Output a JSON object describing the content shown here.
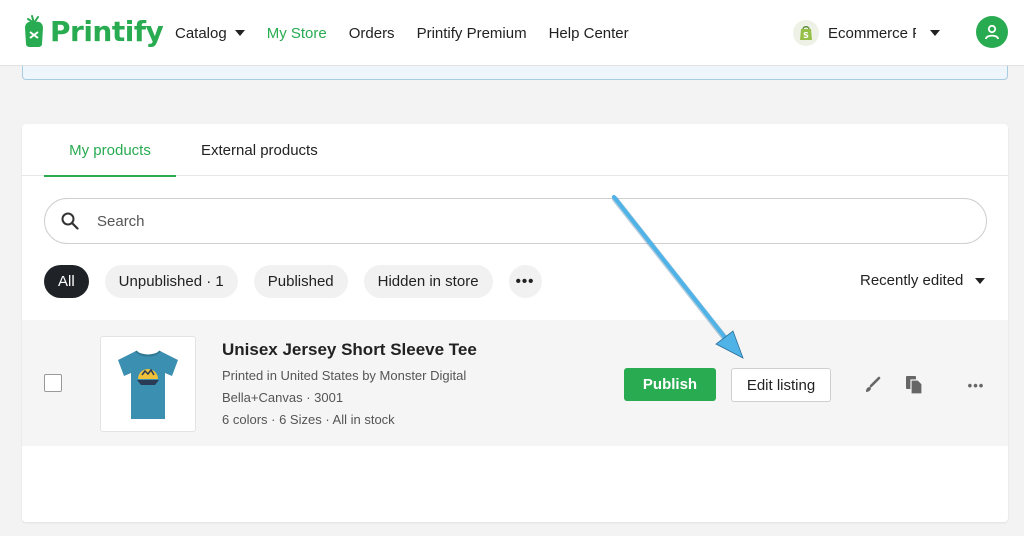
{
  "header": {
    "logo_text": "Printify",
    "nav": [
      {
        "label": "Catalog"
      },
      {
        "label": "My Store"
      },
      {
        "label": "Orders"
      },
      {
        "label": "Printify Premium"
      },
      {
        "label": "Help Center"
      }
    ],
    "store_name": "Ecommerce Platforms",
    "store_icon": "shopify-icon",
    "avatar_icon": "user-icon"
  },
  "tabs": [
    {
      "label": "My products"
    },
    {
      "label": "External products"
    }
  ],
  "search": {
    "placeholder": "Search",
    "value": ""
  },
  "filters": [
    {
      "label": "All"
    },
    {
      "label": "Unpublished · 1"
    },
    {
      "label": "Published"
    },
    {
      "label": "Hidden in store"
    },
    {
      "label": "•••"
    }
  ],
  "sort": {
    "label": "Recently edited"
  },
  "product": {
    "title": "Unisex Jersey Short Sleeve Tee",
    "provider": "Printed in United States by Monster Digital",
    "model": "Bella+Canvas · 3001",
    "variants": "6 colors · 6 Sizes · All in stock",
    "publish_label": "Publish",
    "edit_label": "Edit listing",
    "more_label": "•••"
  },
  "colors": {
    "brand_green": "#29ab51",
    "active_chip": "#1f2328",
    "annotation_arrow": "#4fb3e8",
    "tshirt": "#3b8fb0"
  }
}
